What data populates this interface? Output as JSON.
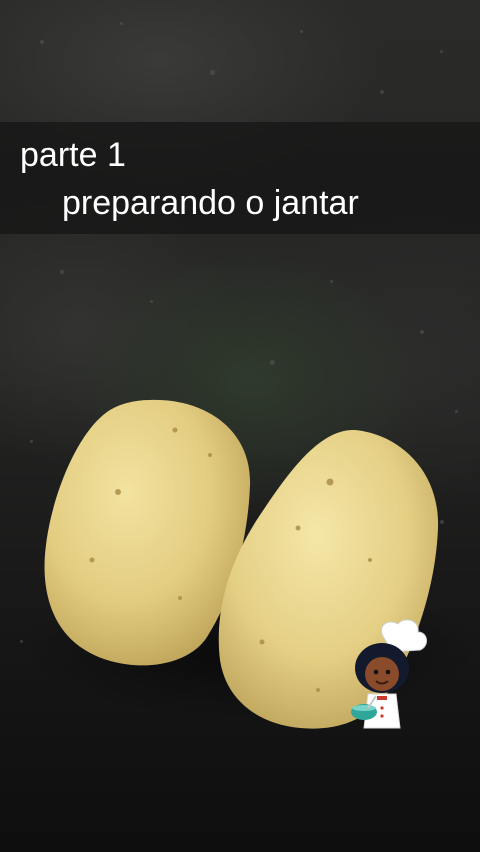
{
  "caption": {
    "line1": "parte 1",
    "line2": "preparando o jantar"
  },
  "scene": {
    "subject": "potatoes",
    "sticker": "chef-character-icon",
    "colors": {
      "background": "#1a1a1a",
      "caption_band": "#161616",
      "caption_text": "#ffffff",
      "potato_skin": "#e3cf83"
    }
  }
}
